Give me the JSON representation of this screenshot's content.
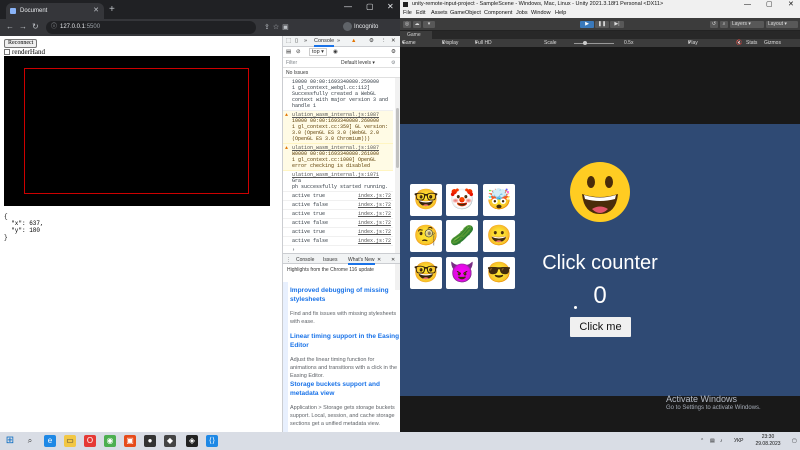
{
  "chrome": {
    "tab_title": "Document",
    "url_host": "127.0.0.1",
    "url_port": ":5500",
    "incognito_label": "Incognito"
  },
  "page": {
    "reconnect_label": "Reconnect",
    "renderhand_label": "renderHand",
    "json_output": "{\n  \"x\": 637,\n  \"y\": 180\n}"
  },
  "devtools": {
    "tabs": [
      "Console"
    ],
    "context": "top",
    "filter_placeholder": "Filter",
    "levels": "Default levels",
    "no_issues": "No Issues",
    "console_lines": [
      {
        "type": "info",
        "text": "10000 00:00:1693340080.259000\n1 gl_context_webgl.cc:112]\nSuccessfully created a WebGL\ncontext with major version 3 and\nhandle 1"
      },
      {
        "type": "warn",
        "link": "ulation_wasm_internal.js:1087",
        "text": "10000 00:00:1693340080.260000\n1 gl_context.cc:359] GL version:\n3.0 (OpenGL ES 3.0 (WebGL 2.0\n(OpenGL ES 3.0 Chromium)))"
      },
      {
        "type": "warn",
        "link": "ulation_wasm_internal.js:1087",
        "text": "W0000 00:00:1693340080.261000\n1 gl_context.cc:1000] OpenGL\nerror checking is disabled"
      },
      {
        "type": "info",
        "link": "ulation_wasm_internal.js:1071",
        "text": "Gra\nph successfully started running."
      },
      {
        "type": "info",
        "text": "active true",
        "src": "index.js:72"
      },
      {
        "type": "info",
        "text": "active false",
        "src": "index.js:72"
      },
      {
        "type": "info",
        "text": "active true",
        "src": "index.js:72"
      },
      {
        "type": "info",
        "text": "active false",
        "src": "index.js:72"
      },
      {
        "type": "info",
        "text": "active true",
        "src": "index.js:72"
      },
      {
        "type": "info",
        "text": "active false",
        "src": "index.js:72"
      }
    ],
    "drawer_tabs": [
      "Console",
      "Issues",
      "What's New"
    ],
    "whats_new_header": "Highlights from the Chrome 116 update",
    "articles": [
      {
        "title": "Improved debugging of missing stylesheets",
        "body": "Find and fix issues with missing stylesheets with ease."
      },
      {
        "title": "Linear timing support in the Easing Editor",
        "body": "Adjust the linear timing function for animations and transitions with a click in the Easing Editor."
      },
      {
        "title": "Storage buckets support and metadata view",
        "body": "Application > Storage gets storage buckets support. Local, session, and cache storage sections get a unified metadata view."
      }
    ]
  },
  "unity": {
    "title": "unity-remote-input-project - SampleScene - Windows, Mac, Linux - Unity 2021.3.18f1 Personal <DX11>",
    "menu": [
      "File",
      "Edit",
      "Assets",
      "GameObject",
      "Component",
      "Jobs",
      "Window",
      "Help"
    ],
    "toolbar_right": [
      "Layers",
      "Layout"
    ],
    "game_tab": "Game",
    "game_bar": {
      "mode": "Game",
      "display": "Display 1",
      "resolution": "Full HD (1920x1080)",
      "scale_label": "Scale",
      "scale_value": "0.5x",
      "play_focused": "Play Focused",
      "stats": "Stats",
      "gizmos": "Gizmos"
    },
    "emojis": [
      "🤓",
      "🤡",
      "🤯",
      "🧐",
      "🥒",
      "😀",
      "🤓",
      "😈",
      "😎"
    ],
    "big_emoji": "😀",
    "counter_title": "Click counter",
    "counter_value": "0",
    "button_label": "Click me",
    "activate_title": "Activate Windows",
    "activate_sub": "Go to Settings to activate Windows."
  },
  "taskbar": {
    "lang": "УКР",
    "time": "23:30",
    "date": "29.08.2023"
  }
}
